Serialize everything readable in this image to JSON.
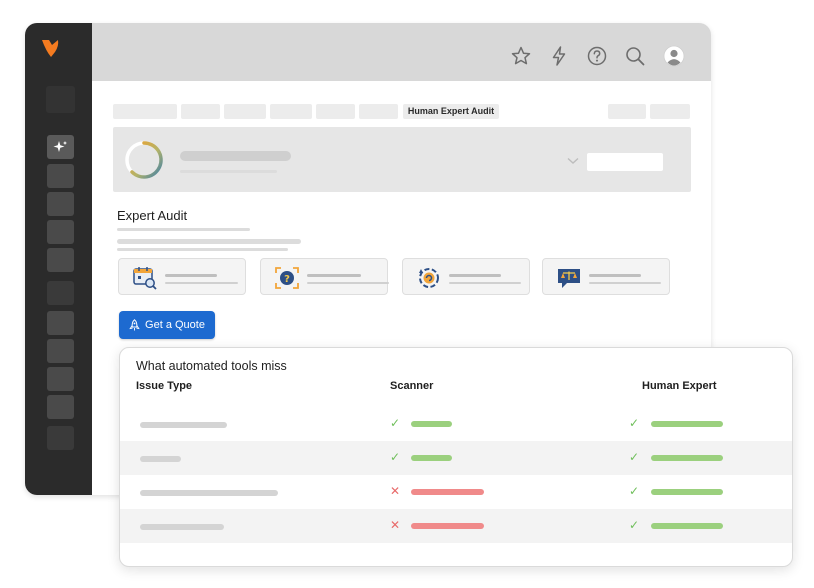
{
  "breadcrumb": {
    "active_label": "Human Expert Audit"
  },
  "section": {
    "title": "Expert Audit"
  },
  "actions": {
    "quote_label": "Get a Quote"
  },
  "comparison": {
    "title": "What automated tools miss",
    "headers": {
      "issue": "Issue Type",
      "scanner": "Scanner",
      "expert": "Human Expert"
    },
    "rows": [
      {
        "scanner": "check",
        "expert": "check"
      },
      {
        "scanner": "check",
        "expert": "check"
      },
      {
        "scanner": "cross",
        "expert": "check"
      },
      {
        "scanner": "cross",
        "expert": "check"
      }
    ]
  },
  "colors": {
    "accent": "#1d6ad0",
    "brand": "#f47b20",
    "success": "#9bd07e",
    "error": "#f08a8a",
    "sidebar": "#2b2b2b"
  },
  "icons": {
    "topbar": [
      "star-icon",
      "bolt-icon",
      "help-icon",
      "search-icon",
      "user-avatar-icon"
    ],
    "sidebar_active": "sparkle-icon",
    "cards": [
      "calendar-search-icon",
      "scan-question-icon",
      "gear-refresh-icon",
      "scales-chat-icon"
    ]
  }
}
